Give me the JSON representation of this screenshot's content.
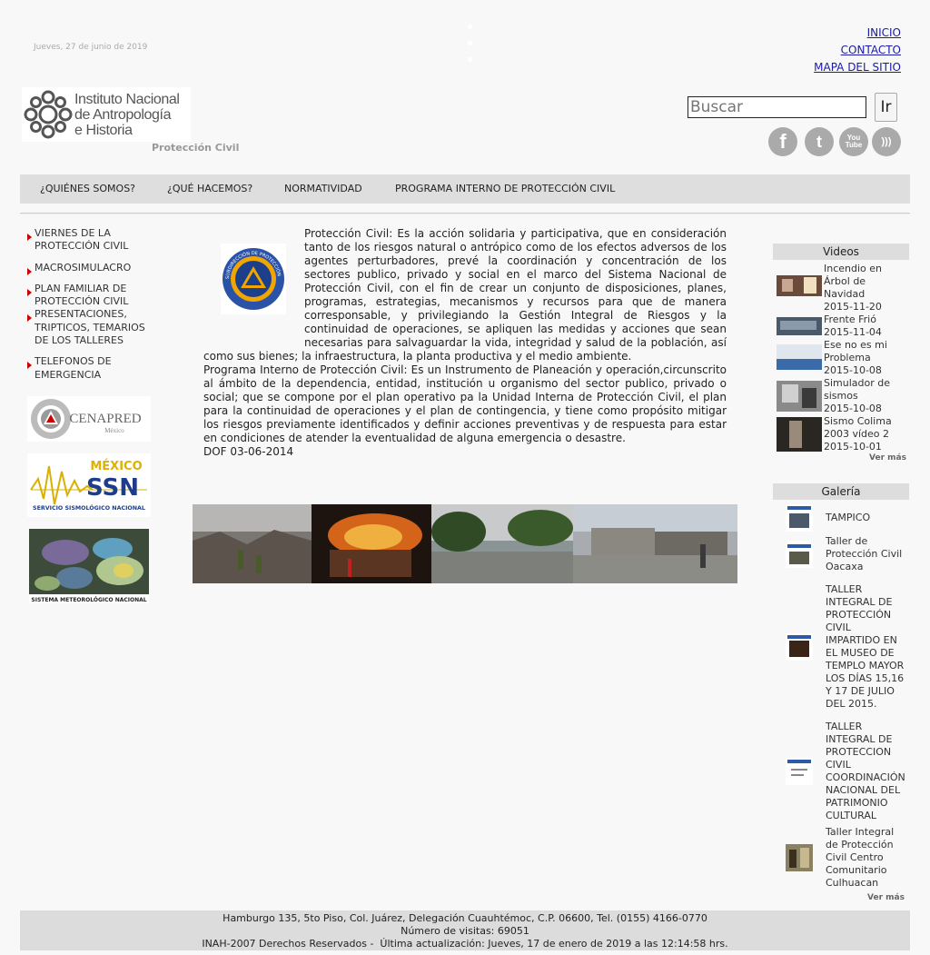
{
  "header": {
    "date": "Jueves, 27 de junio de 2019",
    "links": [
      "INICIO",
      "CONTACTO",
      "MAPA DEL SITIO"
    ],
    "logo_lines": [
      "Instituto Nacional",
      "de Antropología",
      "e Historia"
    ],
    "section_label": "Protección Civil",
    "search_placeholder": "Buscar",
    "search_button": "Ir",
    "social": [
      {
        "name": "facebook-icon",
        "glyph": "f"
      },
      {
        "name": "twitter-icon",
        "glyph": "t"
      },
      {
        "name": "youtube-icon",
        "glyph": "You Tube"
      },
      {
        "name": "rss-icon",
        "glyph": ")))"
      }
    ]
  },
  "nav": [
    "¿QUIÉNES SOMOS?",
    "¿QUÉ HACEMOS?",
    "NORMATIVIDAD",
    "PROGRAMA INTERNO DE PROTECCIÓN CIVIL"
  ],
  "sidebar": {
    "items": [
      "VIERNES DE LA PROTECCIÓN CIVIL",
      "MACROSIMULACRO",
      "PLAN FAMILIAR DE PROTECCIÓN CIVIL",
      "PRESENTACIONES, TRIPTICOS, TEMARIOS DE LOS TALLERES",
      "TELEFONOS DE EMERGENCIA"
    ],
    "banners": {
      "cenapred": "CENAPRED",
      "cenapred_sub": "México",
      "ssn_top": "MÉXICO",
      "ssn_main": "SSN",
      "ssn_sub": "SERVICIO SISMOLÓGICO NACIONAL",
      "smn": "SISTEMA METEOROLÓGICO NACIONAL"
    }
  },
  "main": {
    "emblem_text": "SUBDIRECCIÓN DE PROTECCIÓN CIVIL",
    "paragraph1": "Protección Civil: Es la acción solidaria y participativa, que en consideración tanto de los riesgos natural o antrópico como de los efectos adversos de los agentes perturbadores, prevé la coordinación y concentración de los sectores publico, privado y social en el marco del Sistema Nacional de Protección Civil, con el fin de crear un conjunto de disposiciones, planes, programas, estrategias, mecanismos y recursos para que de manera corresponsable, y privilegiando la Gestión Integral de Riesgos y la continuidad de operaciones, se apliquen las medidas y acciones que sean necesarias para salvaguardar la vida, integridad y salud de la población, así como sus bienes; la infraestructura, la planta productiva y el medio ambiente.",
    "paragraph2": "Programa Interno de Protección Civil: Es un Instrumento de Planeación y operación,circunscrito al ámbito de la dependencia, entidad, institución u organismo del sector publico, privado o social; que se compone por el plan operativo pa la Unidad Interna de Protección Civil, el plan para la continuidad de operaciones y el plan de contingencia, y tiene como propósito mitigar los riesgos previamente identificados y definir acciones preventivas y de respuesta para estar en condiciones de atender la eventualidad de alguna emergencia o desastre.",
    "paragraph3": "DOF 03-06-2014"
  },
  "videos": {
    "title": "Videos",
    "items": [
      {
        "title": "Incendio en Árbol de Navidad",
        "date": "2015-11-20"
      },
      {
        "title": "Frente Frió",
        "date": "2015-11-04"
      },
      {
        "title": "Ese no es mi Problema",
        "date": "2015-10-08"
      },
      {
        "title": "Simulador de sismos",
        "date": "2015-10-08"
      },
      {
        "title": "Sismo Colima 2003 vídeo 2",
        "date": "2015-10-01"
      }
    ],
    "more": "Ver más"
  },
  "gallery": {
    "title": "Galería",
    "items": [
      "TAMPICO",
      "Taller de Protección Civil Oacaxa",
      "TALLER INTEGRAL DE PROTECCIÓN CIVIL IMPARTIDO EN EL MUSEO DE TEMPLO MAYOR LOS DÍAS 15,16 Y 17 DE JULIO DEL 2015.",
      "TALLER INTEGRAL DE PROTECCION CIVIL COORDINACIÓN NACIONAL DEL PATRIMONIO CULTURAL",
      "Taller Integral de Protección Civil Centro Comunitario Culhuacan"
    ],
    "more": "Ver más"
  },
  "footer": {
    "address": "Hamburgo 135, 5to Piso, Col. Juárez, Delegación Cuauhtémoc, C.P. 06600, Tel. (0155) 4166-0770",
    "visits": "Número de visitas: 69051",
    "rights": "INAH-2007 Derechos Reservados -  Última actualización: Jueves, 17 de enero de 2019 a las 12:14:58 hrs."
  }
}
